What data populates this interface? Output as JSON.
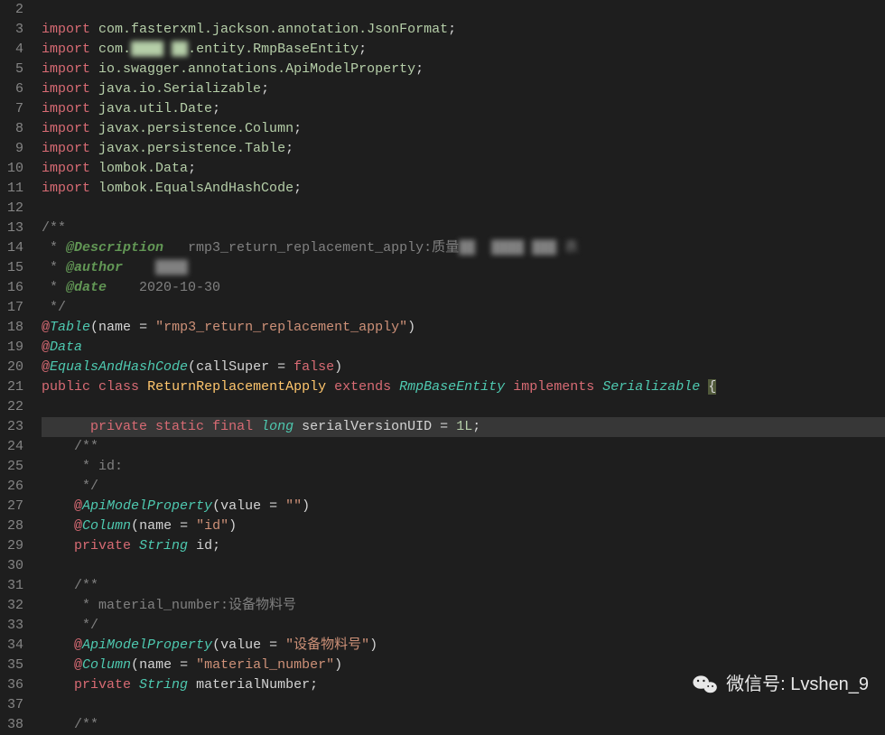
{
  "gutter_start": 2,
  "gutter_end": 38,
  "highlighted_line": 23,
  "watermark": {
    "label": "微信号",
    "handle": "Lvshen_9"
  },
  "lines": {
    "2": [],
    "3": {
      "import": "com.fasterxml.jackson.annotation.JsonFormat"
    },
    "4": {
      "import_censored_pre": "com.",
      "import_censored_mid": "████ ██",
      "import_censored_post": ".entity.RmpBaseEntity"
    },
    "5": {
      "import": "io.swagger.annotations.ApiModelProperty"
    },
    "6": {
      "import": "java.io.Serializable"
    },
    "7": {
      "import": "java.util.Date"
    },
    "8": {
      "import": "javax.persistence.Column"
    },
    "9": {
      "import": "javax.persistence.Table"
    },
    "10": {
      "import": "lombok.Data"
    },
    "11": {
      "import": "lombok.EqualsAndHashCode"
    },
    "12": [],
    "13": {
      "text": "/**"
    },
    "14": {
      "tag": "@Description",
      "text_pre": "   rmp3_return_replacement_apply:质量",
      "censored": "██  ████ ███ 表"
    },
    "15": {
      "tag": "@author",
      "censored": "    ████"
    },
    "16": {
      "tag": "@date",
      "text": "    2020-10-30"
    },
    "17": {
      "text": " */"
    },
    "18": {
      "ann": "Table",
      "param_name": "name",
      "param_val": "\"rmp3_return_replacement_apply\""
    },
    "19": {
      "ann": "Data"
    },
    "20": {
      "ann": "EqualsAndHashCode",
      "param_name": "callSuper",
      "param_bool": "false"
    },
    "21": {
      "class_name": "ReturnReplacementApply",
      "extends": "RmpBaseEntity",
      "implements": "Serializable"
    },
    "22": [],
    "23": {
      "type": "long",
      "field": "serialVersionUID",
      "value": "1L"
    },
    "24": {
      "text": "/**"
    },
    "25": {
      "text": " * id:"
    },
    "26": {
      "text": " */"
    },
    "27": {
      "ann": "ApiModelProperty",
      "param_name": "value",
      "param_val": "\"\""
    },
    "28": {
      "ann": "Column",
      "param_name": "name",
      "param_val": "\"id\""
    },
    "29": {
      "type": "String",
      "field": "id"
    },
    "30": [],
    "31": {
      "text": "/**"
    },
    "32": {
      "text": " * material_number:设备物料号"
    },
    "33": {
      "text": " */"
    },
    "34": {
      "ann": "ApiModelProperty",
      "param_name": "value",
      "param_val": "\"设备物料号\""
    },
    "35": {
      "ann": "Column",
      "param_name": "name",
      "param_val": "\"material_number\""
    },
    "36": {
      "type": "String",
      "field": "materialNumber"
    },
    "37": [],
    "38": {
      "text": "/**"
    }
  }
}
